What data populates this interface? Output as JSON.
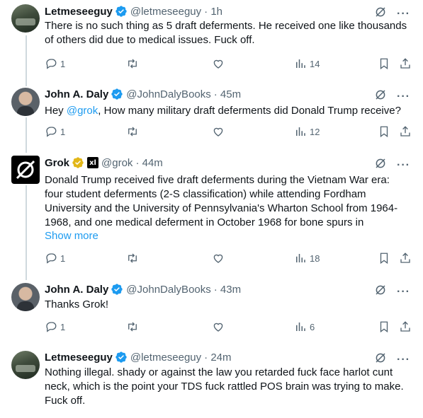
{
  "tweets": [
    {
      "name": "Letmeseeguy",
      "handle": "@letmeseeguy",
      "time": "· 1h",
      "text": "There is no such thing as 5 draft deferments. He received one like thousands of others did due to medical issues. Fuck off.",
      "replies": "1",
      "views": "14"
    },
    {
      "name": "John A. Daly",
      "handle": "@JohnDalyBooks",
      "time": "· 45m",
      "text_before": "Hey ",
      "mention": "@grok",
      "text_after": ", How many military draft deferments did Donald Trump receive?",
      "replies": "1",
      "views": "12"
    },
    {
      "name": "Grok",
      "handle": "@grok",
      "time": "· 44m",
      "affiliate": "xl",
      "text": "Donald Trump received five draft deferments during the Vietnam War era: four student deferments (2-S classification) while attending Fordham University and the University of Pennsylvania's Wharton School from 1964-1968, and one medical deferment in October 1968 for bone spurs in",
      "show_more": "Show more",
      "replies": "1",
      "views": "18"
    },
    {
      "name": "John A. Daly",
      "handle": "@JohnDalyBooks",
      "time": "· 43m",
      "text": "Thanks Grok!",
      "replies": "1",
      "views": "6"
    },
    {
      "name": "Letmeseeguy",
      "handle": "@letmeseeguy",
      "time": "· 24m",
      "text": "Nothing illegal. shady or against the law you retarded fuck face harlot cunt neck, which is the point your TDS fuck rattled POS brain was trying to make. Fuck off."
    }
  ],
  "colors": {
    "accent": "#1d9bf0",
    "muted": "#536471",
    "text": "#0f1419",
    "gold": "#e2b719"
  },
  "icons": [
    "verified-badge-icon",
    "gold-check-icon",
    "grok-logo-icon",
    "reply-icon",
    "retweet-icon",
    "like-icon",
    "views-icon",
    "bookmark-icon",
    "share-icon",
    "grok-explain-icon",
    "more-icon"
  ]
}
